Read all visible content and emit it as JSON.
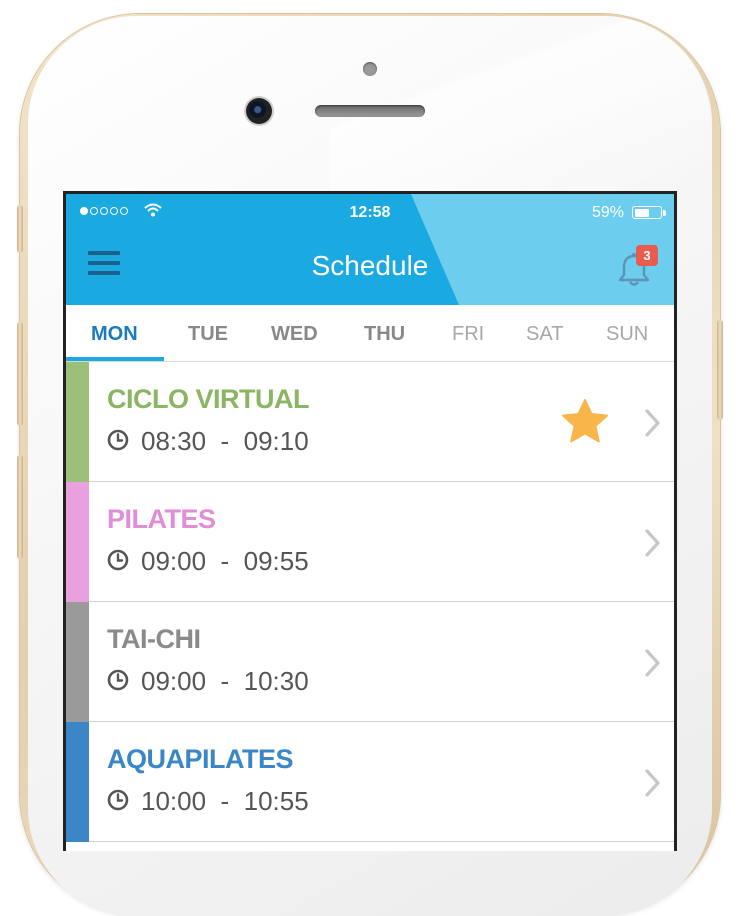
{
  "status_bar": {
    "time": "12:58",
    "battery_pct": "59%",
    "battery_level": 0.59,
    "signal_bars_filled": 1,
    "signal_bars_total": 5
  },
  "header": {
    "title": "Schedule",
    "notification_count": "3",
    "colors": {
      "primary": "#1aa9e1",
      "light": "#6ccdee",
      "badge": "#e95a4f"
    }
  },
  "tabs": [
    {
      "label": "MON",
      "state": "active"
    },
    {
      "label": "TUE",
      "state": "normal"
    },
    {
      "label": "WED",
      "state": "normal"
    },
    {
      "label": "THU",
      "state": "normal"
    },
    {
      "label": "FRI",
      "state": "faded"
    },
    {
      "label": "SAT",
      "state": "faded"
    },
    {
      "label": "SUN",
      "state": "faded"
    }
  ],
  "classes": [
    {
      "name": "CICLO VIRTUAL",
      "start": "08:30",
      "end": "09:10",
      "sep": "-",
      "color": "#8ab562",
      "bar_color": "#9cc07a",
      "favorite": true
    },
    {
      "name": "PILATES",
      "start": "09:00",
      "end": "09:55",
      "sep": "-",
      "color": "#e08fd7",
      "bar_color": "#e8a0de",
      "favorite": false
    },
    {
      "name": "TAI-CHI",
      "start": "09:00",
      "end": "10:30",
      "sep": "-",
      "color": "#8a8a8a",
      "bar_color": "#9a9a9a",
      "favorite": false
    },
    {
      "name": "AQUAPILATES",
      "start": "10:00",
      "end": "10:55",
      "sep": "-",
      "color": "#3b86c7",
      "bar_color": "#3b86c7",
      "favorite": false
    }
  ],
  "icons": {
    "menu": "menu-icon",
    "bell": "bell-icon",
    "clock": "clock-icon",
    "star": "star-icon",
    "chevron": "chevron-right-icon",
    "wifi": "wifi-icon",
    "battery": "battery-icon"
  }
}
